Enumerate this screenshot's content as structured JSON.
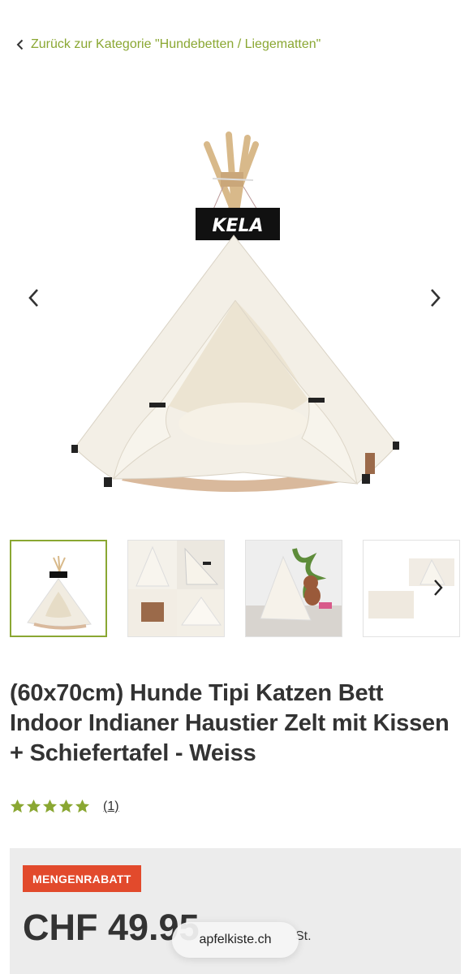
{
  "breadcrumb": {
    "back_label": "Zurück zur Kategorie \"Hundebetten / Liegematten\""
  },
  "hero": {
    "sign_text": "KELA",
    "prev_icon": "chevron-left-icon",
    "next_icon": "chevron-right-icon"
  },
  "thumbnails": {
    "active_index": 0,
    "count_visible": 4
  },
  "product": {
    "title": "(60x70cm) Hunde Tipi Katzen Bett Indoor Indianer Haustier Zelt mit Kissen + Schiefertafel - Weiss",
    "rating": 5,
    "reviews_label": "(1)"
  },
  "pricing": {
    "badge": "MENGENRABATT",
    "price": "CHF 49.95",
    "unit": "St."
  },
  "browser": {
    "url": "apfelkiste.ch"
  },
  "colors": {
    "accent": "#8aa732",
    "badge": "#e24a2c",
    "star": "#8aa732"
  }
}
